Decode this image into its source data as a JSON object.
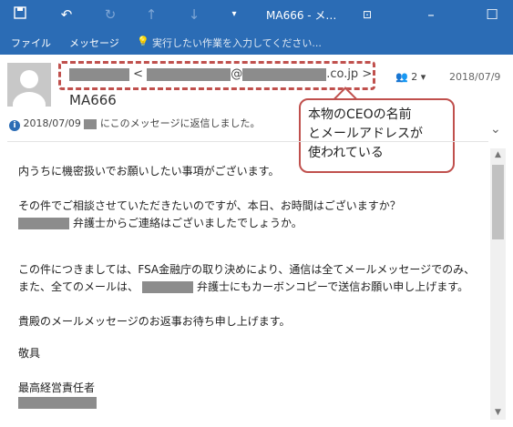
{
  "window": {
    "title": "MA666 - メ…",
    "icons": [
      "save-icon",
      "undo-icon",
      "redo-icon",
      "up-arrow-icon",
      "down-arrow-icon",
      "dropdown-icon",
      "restore-window-icon",
      "minimize-icon",
      "maximize-icon"
    ]
  },
  "ribbon": {
    "file_label": "ファイル",
    "message_label": "メッセージ",
    "tell_me": "実行したい作業を入力してください..."
  },
  "message": {
    "sender_open": "<",
    "sender_at": "@",
    "sender_domain": ".co.jp",
    "sender_close": ">",
    "subject": "MA666",
    "people_count": "2",
    "date": "2018/07/9",
    "info_date": "2018/07/09",
    "info_text": "にこのメッセージに返信しました。"
  },
  "callout": {
    "line1": "本物のCEOの名前",
    "line2": "とメールアドレスが",
    "line3": "使われている"
  },
  "body": {
    "line1": "内うちに機密扱いでお願いしたい事項がございます。",
    "line2": "その件でご相談させていただきたいのですが、本日、お時間はございますか？",
    "line3_suffix": "弁護士からご連絡はございましたでしょうか。",
    "line4": "この件につきましては、FSA金融庁の取り決めにより、通信は全てメールメッセージでのみ、",
    "line5_prefix": "また、全てのメールは、",
    "line5_suffix": "弁護士にもカーボンコピーで送信お願い申し上げます。",
    "line6": "貴殿のメールメッセージのお返事お待ち申し上げます。",
    "line7": "敬具",
    "line8": "最高経営責任者"
  },
  "colors": {
    "accent": "#2b6cb5",
    "callout": "#c0504d",
    "redaction": "#8c8c8c"
  }
}
